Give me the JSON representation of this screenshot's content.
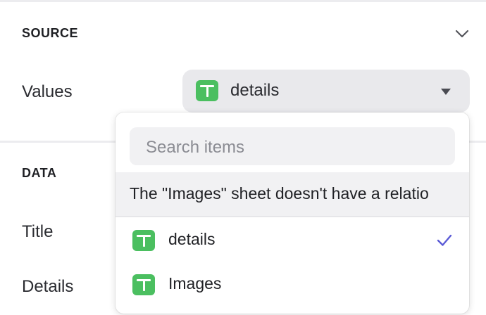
{
  "source": {
    "title": "SOURCE",
    "values_label": "Values",
    "selected_value": "details"
  },
  "data_section": {
    "title": "DATA",
    "fields": [
      "Title",
      "Details"
    ]
  },
  "dropdown": {
    "search_placeholder": "Search items",
    "notice": "The \"Images\" sheet doesn't have a relatio",
    "items": [
      {
        "label": "details",
        "selected": true,
        "icon": "sheet-icon"
      },
      {
        "label": "Images",
        "selected": false,
        "icon": "sheet-icon"
      }
    ]
  },
  "colors": {
    "sheet_icon": "#4bbf60",
    "check": "#5b5bd6",
    "select_bg": "#e9e9ec"
  }
}
